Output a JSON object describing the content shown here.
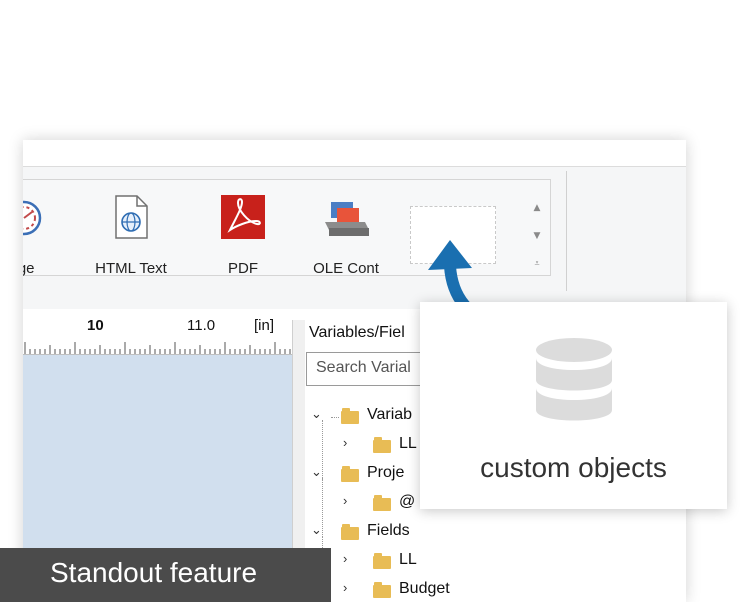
{
  "ribbon": {
    "tools": [
      {
        "label": "uge",
        "icon": "gauge-icon"
      },
      {
        "label": "HTML Text",
        "icon": "html-text-icon"
      },
      {
        "label": "PDF",
        "icon": "pdf-icon"
      },
      {
        "label": "OLE Cont",
        "icon": "ole-container-icon"
      }
    ]
  },
  "ruler": {
    "mark_10": "10",
    "mark_11": "11.0",
    "unit": "[in]"
  },
  "panel": {
    "title": "Variables/Fiel",
    "search_placeholder": "Search Varial",
    "tree": [
      {
        "label": "Variab",
        "expanded": true,
        "icon": "variables-folder-icon"
      },
      {
        "label": "LL",
        "expanded": false,
        "icon": "folder-icon"
      },
      {
        "label": "Proje",
        "expanded": true,
        "icon": "project-folder-icon"
      },
      {
        "label": "@",
        "expanded": false,
        "icon": "folder-icon"
      },
      {
        "label": "Fields",
        "expanded": true,
        "icon": "fields-folder-icon"
      },
      {
        "label": "LL",
        "expanded": false,
        "icon": "folder-icon"
      },
      {
        "label": "Budget",
        "expanded": false,
        "icon": "folder-icon"
      }
    ]
  },
  "callout": {
    "caption": "custom objects",
    "icon": "database-icon",
    "arrow_color": "#1a6fb0"
  },
  "badge": {
    "text": "Standout feature"
  }
}
